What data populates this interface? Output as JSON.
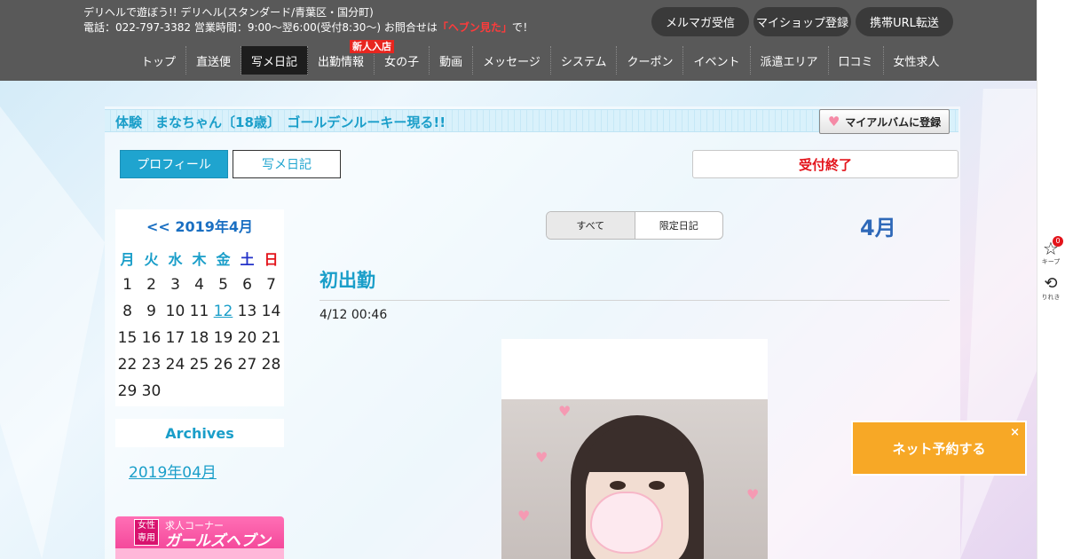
{
  "header": {
    "line1": "デリヘルで遊ぼう!! デリヘル(スタンダード/青葉区・国分町)",
    "line2_prefix": "電話：022-797-3382 営業時間：9:00～翌6:00(受付8:30～) お問合せは",
    "line2_highlight": "「ヘブン見た」",
    "line2_suffix": "で！",
    "buttons": [
      "メルマガ受信",
      "マイショップ登録",
      "携帯URL転送"
    ]
  },
  "nav": {
    "items": [
      "トップ",
      "直送便",
      "写メ日記",
      "出勤情報",
      "女の子",
      "動画",
      "メッセージ",
      "システム",
      "クーポン",
      "イベント",
      "派遣エリア",
      "口コミ",
      "女性求人"
    ],
    "active_index": 2,
    "badge": "新人入店"
  },
  "profile": {
    "title": "体験　まなちゃん〔18歳〕　ゴールデンルーキー現る!!",
    "album_button": "マイアルバムに登録",
    "tab_profile": "プロフィール",
    "tab_diary": "写メ日記",
    "status": "受付終了"
  },
  "calendar": {
    "title": "<< 2019年4月",
    "weekdays": [
      "月",
      "火",
      "水",
      "木",
      "金",
      "土",
      "日"
    ],
    "days": [
      "1",
      "2",
      "3",
      "4",
      "5",
      "6",
      "7",
      "8",
      "9",
      "10",
      "11",
      "12",
      "13",
      "14",
      "15",
      "16",
      "17",
      "18",
      "19",
      "20",
      "21",
      "22",
      "23",
      "24",
      "25",
      "26",
      "27",
      "28",
      "29",
      "30"
    ],
    "linked_day": "12"
  },
  "archives": {
    "title": "Archives",
    "link": "2019年04月"
  },
  "banner": {
    "tag": "女性専用",
    "sub": "求人コーナー",
    "main": "ガールズヘブン"
  },
  "diary": {
    "filter_all": "すべて",
    "filter_limited": "限定日記",
    "month": "4月",
    "entry_title": "初出勤",
    "entry_date": "4/12 00:46"
  },
  "side": {
    "keep_count": "0",
    "keep_label": "キープ",
    "history_label": "りれき"
  },
  "reserve": {
    "label": "ネット予約する",
    "close": "×"
  },
  "colors": {
    "accent": "#1fa4cf",
    "header_bg": "#595959",
    "status_red": "#e3141b",
    "reserve_orange": "#f7a826"
  }
}
